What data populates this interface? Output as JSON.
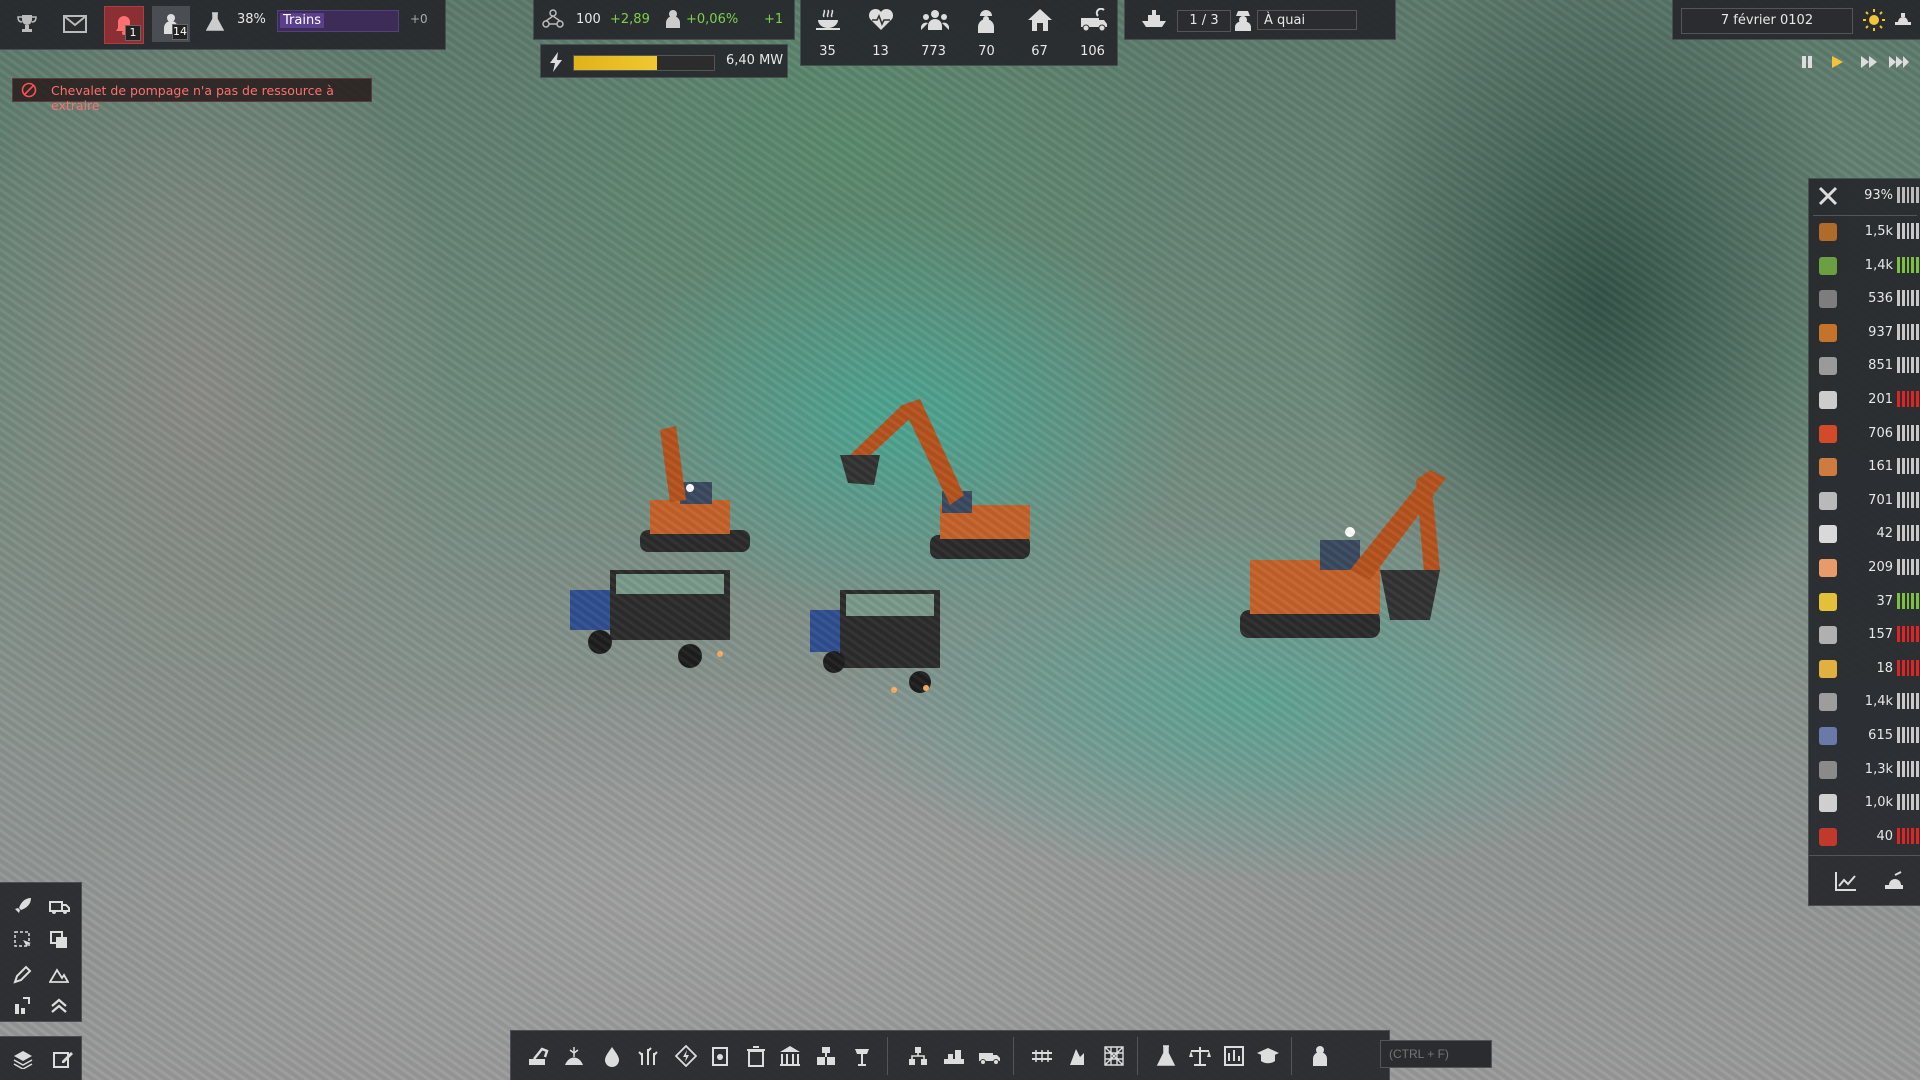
{
  "top_left": {
    "notification_count": "1",
    "worker_count": "14",
    "research_percent": "38%",
    "research_name": "Trains",
    "research_extra": "+0"
  },
  "alert": {
    "message": "Chevalet de pompage n'a pas de ressource à extraire"
  },
  "unity": {
    "value": "100",
    "delta": "+2,89",
    "pop_growth": "+0,06%",
    "pop_extra": "+1"
  },
  "power": {
    "value": "6,40 MW",
    "fill_percent": 59
  },
  "stats": [
    {
      "icon": "food-icon",
      "value": "35"
    },
    {
      "icon": "health-icon",
      "value": "13"
    },
    {
      "icon": "population-icon",
      "value": "773"
    },
    {
      "icon": "workers-icon",
      "value": "70"
    },
    {
      "icon": "housing-icon",
      "value": "67"
    },
    {
      "icon": "vehicles-icon",
      "value": "106"
    }
  ],
  "ships": {
    "count": "1 / 3",
    "status": "À quai"
  },
  "date": {
    "text": "7 février 0102"
  },
  "maintenance": {
    "value": "93%"
  },
  "resources": [
    {
      "icon": "wood-icon",
      "value": "1,5k",
      "color": "#b06a2a",
      "bar": "#c8c8c8"
    },
    {
      "icon": "food-crop-icon",
      "value": "1,4k",
      "color": "#6aa042",
      "bar": "#7cc043"
    },
    {
      "icon": "rock-icon",
      "value": "536",
      "color": "#7d7d7d",
      "bar": "#c8c8c8"
    },
    {
      "icon": "barrel-icon",
      "value": "937",
      "color": "#c5732a",
      "bar": "#c8c8c8"
    },
    {
      "icon": "metal-plate-icon",
      "value": "851",
      "color": "#9a9a9a",
      "bar": "#c8c8c8"
    },
    {
      "icon": "tool-icon",
      "value": "201",
      "color": "#cccccc",
      "bar": "#e02424"
    },
    {
      "icon": "fuel-can-icon",
      "value": "706",
      "color": "#d24a2a",
      "bar": "#c8c8c8"
    },
    {
      "icon": "copper-bar-icon",
      "value": "161",
      "color": "#cf7a3e",
      "bar": "#c8c8c8"
    },
    {
      "icon": "iron-bar-icon",
      "value": "701",
      "color": "#b9b9b9",
      "bar": "#c8c8c8"
    },
    {
      "icon": "machine-parts-icon",
      "value": "42",
      "color": "#d9d9d9",
      "bar": "#c8c8c8"
    },
    {
      "icon": "crate-icon",
      "value": "209",
      "color": "#e89a6a",
      "bar": "#c8c8c8"
    },
    {
      "icon": "gold-parts-icon",
      "value": "37",
      "color": "#e3c03a",
      "bar": "#7cc043"
    },
    {
      "icon": "vehicle-parts-icon",
      "value": "157",
      "color": "#b0b0b0",
      "bar": "#e02424"
    },
    {
      "icon": "electronics-icon",
      "value": "18",
      "color": "#e0b040",
      "bar": "#e02424"
    },
    {
      "icon": "concrete-icon",
      "value": "1,4k",
      "color": "#9d9d9d",
      "bar": "#c8c8c8"
    },
    {
      "icon": "steel-icon",
      "value": "615",
      "color": "#6a7aa8",
      "bar": "#c8c8c8"
    },
    {
      "icon": "gravel-icon",
      "value": "1,3k",
      "color": "#8a8a8a",
      "bar": "#c8c8c8"
    },
    {
      "icon": "glass-icon",
      "value": "1,0k",
      "color": "#cfcfcf",
      "bar": "#c8c8c8"
    },
    {
      "icon": "bricks-icon",
      "value": "40",
      "color": "#c0392b",
      "bar": "#e02424"
    }
  ],
  "search": {
    "placeholder": "(CTRL + F)"
  }
}
